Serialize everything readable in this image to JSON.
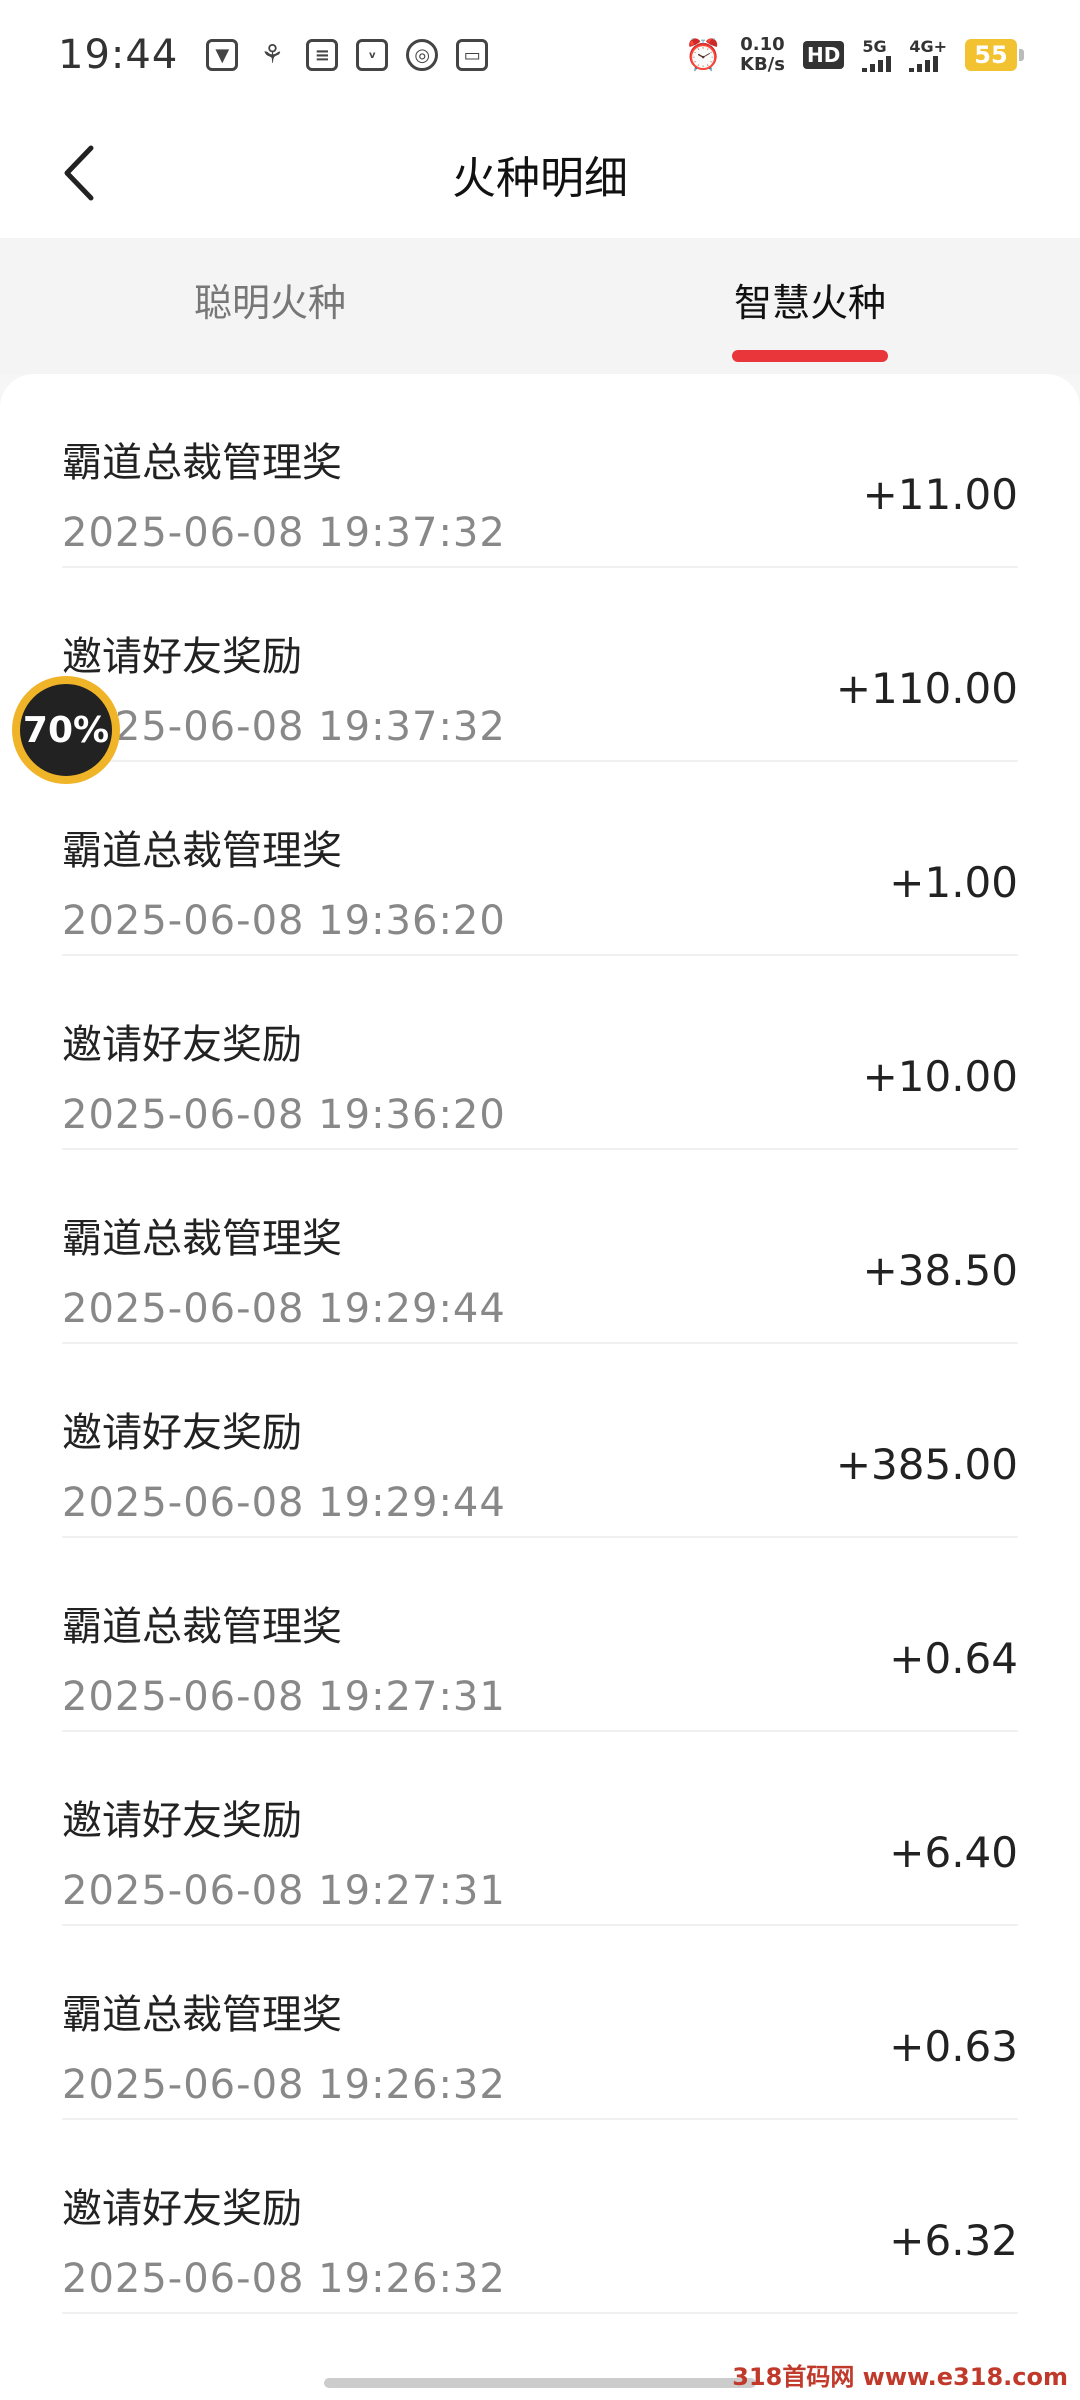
{
  "status_bar": {
    "time": "19:44",
    "net_speed_value": "0.10",
    "net_speed_unit": "KB/s",
    "hd_label": "HD",
    "sig1_label": "5G",
    "sig2_label": "4G+",
    "battery": "55"
  },
  "header": {
    "title": "火种明细"
  },
  "tabs": [
    {
      "label": "聪明火种",
      "active": false
    },
    {
      "label": "智慧火种",
      "active": true
    }
  ],
  "items": [
    {
      "title": "霸道总裁管理奖",
      "time": "2025-06-08 19:37:32",
      "amount": "+11.00"
    },
    {
      "title": "邀请好友奖励",
      "time": "2025-06-08 19:37:32",
      "amount": "+110.00"
    },
    {
      "title": "霸道总裁管理奖",
      "time": "2025-06-08 19:36:20",
      "amount": "+1.00"
    },
    {
      "title": "邀请好友奖励",
      "time": "2025-06-08 19:36:20",
      "amount": "+10.00"
    },
    {
      "title": "霸道总裁管理奖",
      "time": "2025-06-08 19:29:44",
      "amount": "+38.50"
    },
    {
      "title": "邀请好友奖励",
      "time": "2025-06-08 19:29:44",
      "amount": "+385.00"
    },
    {
      "title": "霸道总裁管理奖",
      "time": "2025-06-08 19:27:31",
      "amount": "+0.64"
    },
    {
      "title": "邀请好友奖励",
      "time": "2025-06-08 19:27:31",
      "amount": "+6.40"
    },
    {
      "title": "霸道总裁管理奖",
      "time": "2025-06-08 19:26:32",
      "amount": "+0.63"
    },
    {
      "title": "邀请好友奖励",
      "time": "2025-06-08 19:26:32",
      "amount": "+6.32"
    }
  ],
  "floating_badge": {
    "label": "70%"
  },
  "watermark": "318首码网 www.e318.com",
  "colors": {
    "accent": "#e8363b",
    "badge_ring": "#f0b428"
  }
}
